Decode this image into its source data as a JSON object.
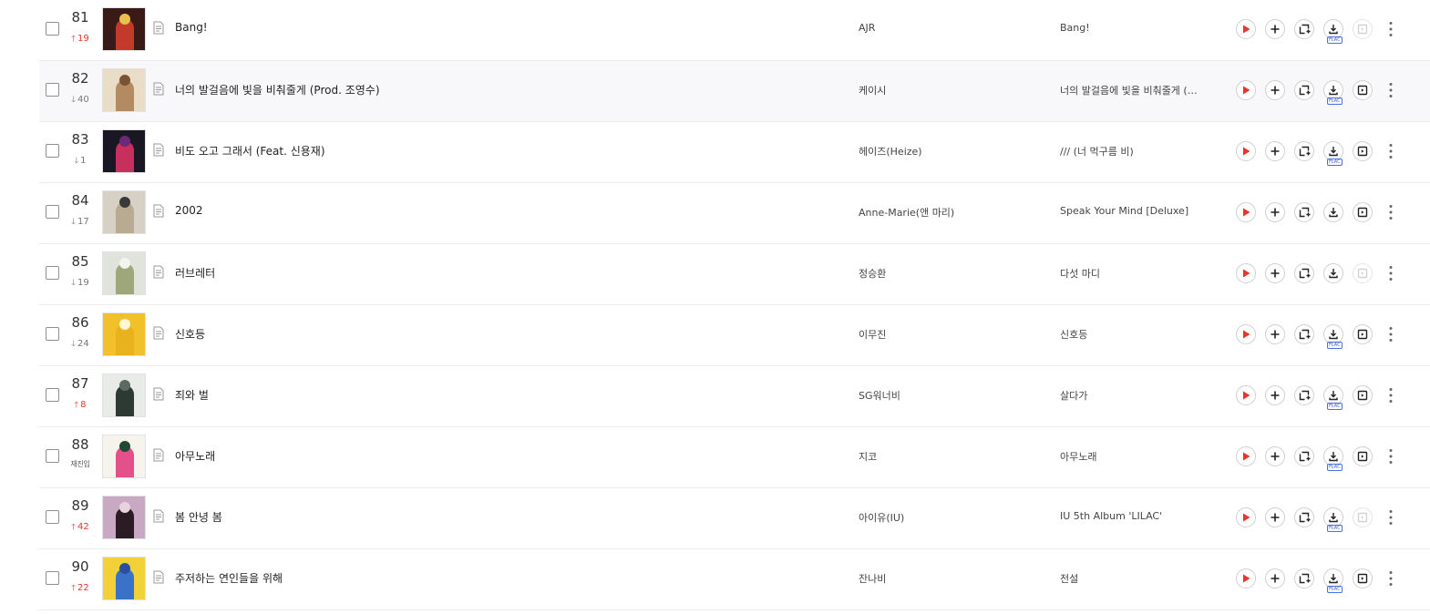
{
  "rows": [
    {
      "rank": "81",
      "change_dir": "up",
      "change_text": "19",
      "title": "Bang!",
      "artist": "AJR",
      "album": "Bang!",
      "flac": true,
      "mv_available": false,
      "art_colors": [
        "#3a1a16",
        "#c43a2a",
        "#e8c24a"
      ]
    },
    {
      "rank": "82",
      "change_dir": "down",
      "change_text": "40",
      "title": "너의 발걸음에 빛을 비춰줄게 (Prod. 조영수)",
      "artist": "케이시",
      "album": "너의 발걸음에 빛을 비춰줄게 (…",
      "flac": true,
      "mv_available": true,
      "art_colors": [
        "#e9ddc8",
        "#b48a62",
        "#7a5234"
      ]
    },
    {
      "rank": "83",
      "change_dir": "down",
      "change_text": "1",
      "title": "비도 오고 그래서 (Feat. 신용재)",
      "artist": "헤이즈(Heize)",
      "album": "/// (너 먹구름 비)",
      "flac": true,
      "mv_available": true,
      "art_colors": [
        "#1a1624",
        "#c72f5c",
        "#6a2a7a"
      ]
    },
    {
      "rank": "84",
      "change_dir": "down",
      "change_text": "17",
      "title": "2002",
      "artist": "Anne-Marie(앤 마리)",
      "album": "Speak Your Mind [Deluxe]",
      "flac": false,
      "mv_available": true,
      "art_colors": [
        "#d7d0c4",
        "#b9ab92",
        "#3a3a3a"
      ]
    },
    {
      "rank": "85",
      "change_dir": "down",
      "change_text": "19",
      "title": "러브레터",
      "artist": "정승환",
      "album": "다섯 마디",
      "flac": false,
      "mv_available": false,
      "art_colors": [
        "#dfe3dc",
        "#9da77a",
        "#f3f3ef"
      ]
    },
    {
      "rank": "86",
      "change_dir": "down",
      "change_text": "24",
      "title": "신호등",
      "artist": "이무진",
      "album": "신호등",
      "flac": true,
      "mv_available": true,
      "art_colors": [
        "#f2c02b",
        "#e7b21e",
        "#fff6d6"
      ]
    },
    {
      "rank": "87",
      "change_dir": "up",
      "change_text": "8",
      "title": "죄와 벌",
      "artist": "SG워너비",
      "album": "살다가",
      "flac": true,
      "mv_available": true,
      "art_colors": [
        "#e8ebe7",
        "#2c3a33",
        "#5b6a62"
      ]
    },
    {
      "rank": "88",
      "change_dir": "new",
      "change_text": "재진입",
      "title": "아무노래",
      "artist": "지코",
      "album": "아무노래",
      "flac": true,
      "mv_available": true,
      "art_colors": [
        "#f6f2ec",
        "#e4508a",
        "#1d4a32"
      ]
    },
    {
      "rank": "89",
      "change_dir": "up",
      "change_text": "42",
      "title": "봄 안녕 봄",
      "artist": "아이유(IU)",
      "album": "IU 5th Album 'LILAC'",
      "flac": true,
      "mv_available": false,
      "art_colors": [
        "#c9a8c4",
        "#2b1c24",
        "#e8d3dd"
      ]
    },
    {
      "rank": "90",
      "change_dir": "up",
      "change_text": "22",
      "title": "주저하는 연인들을 위해",
      "artist": "잔나비",
      "album": "전설",
      "flac": true,
      "mv_available": true,
      "art_colors": [
        "#f0d13a",
        "#3a72c8",
        "#2a4fa0"
      ]
    }
  ],
  "icons": {
    "checkbox": "checkbox-icon",
    "lyrics": "lyrics-icon",
    "play": "play-icon",
    "add": "plus-icon",
    "add_to_playlist": "playlist-add-icon",
    "download": "download-icon",
    "music_video": "mv-icon",
    "more": "more-vertical-icon"
  },
  "colors": {
    "accent_red": "#e6352b",
    "flac_blue": "#4a6fe0",
    "row_highlight": "#f8f8fa"
  },
  "labels": {
    "flac": "FLAC",
    "arrow_up": "🡑",
    "arrow_down": "🡓"
  }
}
